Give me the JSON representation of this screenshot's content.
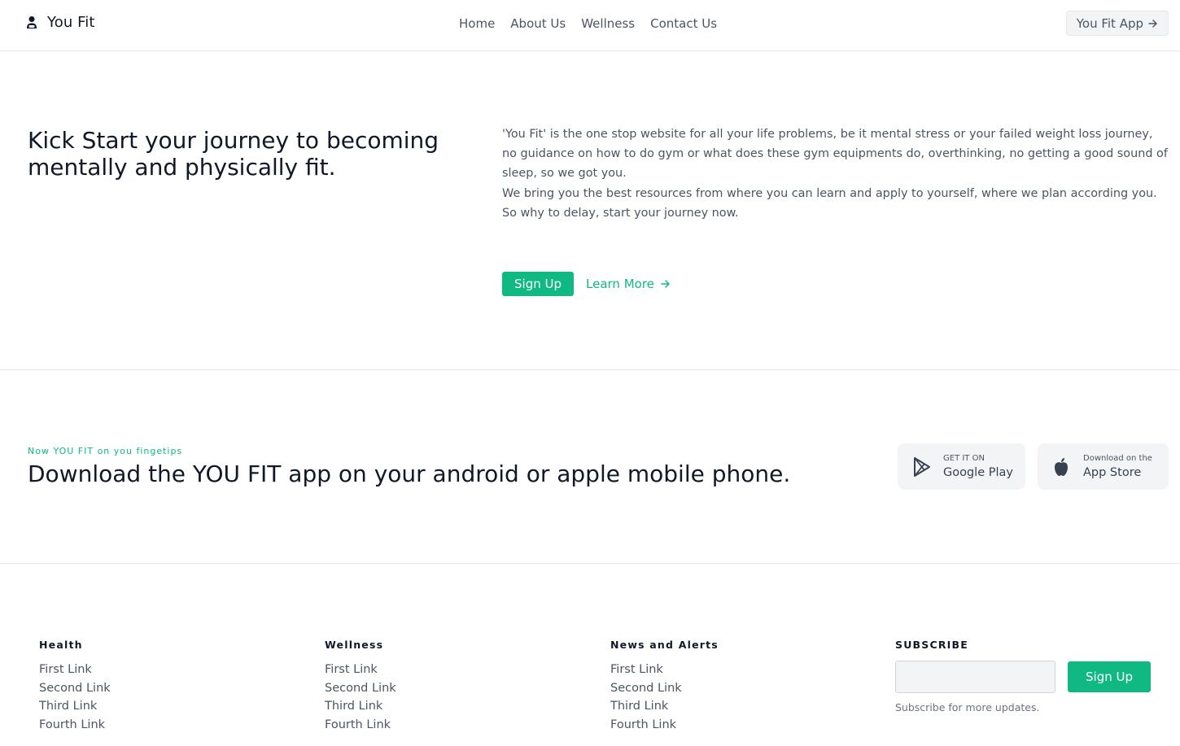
{
  "header": {
    "brand": "You Fit",
    "nav": [
      "Home",
      "About Us",
      "Wellness",
      "Contact Us"
    ],
    "app_button": "You Fit App"
  },
  "hero": {
    "title": "Kick Start your journey to becoming mentally and physically fit.",
    "paragraph1": "'You Fit' is the one stop website for all your life problems, be it mental stress or your failed weight loss journey, no guidance on how to do gym or what does these gym equipments do, overthinking, no getting a good sound of sleep, so we got you.",
    "paragraph2": "We bring you the best resources from where you can learn and apply to yourself, where we plan according you. So why to delay, start your journey now.",
    "signup": "Sign Up",
    "learn_more": "Learn More"
  },
  "download": {
    "kicker": "Now YOU FIT on you fingetips",
    "title": "Download the YOU FIT app on your android or apple mobile phone.",
    "google": {
      "small": "GET IT ON",
      "big": "Google Play"
    },
    "apple": {
      "small": "Download on the",
      "big": "App Store"
    }
  },
  "footer": {
    "columns": [
      {
        "title": "Health",
        "links": [
          "First Link",
          "Second Link",
          "Third Link",
          "Fourth Link"
        ]
      },
      {
        "title": "Wellness",
        "links": [
          "First Link",
          "Second Link",
          "Third Link",
          "Fourth Link"
        ]
      },
      {
        "title": "News and Alerts",
        "links": [
          "First Link",
          "Second Link",
          "Third Link",
          "Fourth Link"
        ]
      }
    ],
    "subscribe": {
      "title": "SUBSCRIBE",
      "input_value": "",
      "button": "Sign Up",
      "note": "Subscribe for more updates."
    }
  },
  "colors": {
    "accent": "#10b981",
    "text": "#111827",
    "muted": "#4b5563",
    "border": "#e5e7eb"
  },
  "icons": {
    "brand": "person-icon",
    "arrow": "arrow-right-icon",
    "google": "play-store-icon",
    "apple": "apple-icon"
  }
}
